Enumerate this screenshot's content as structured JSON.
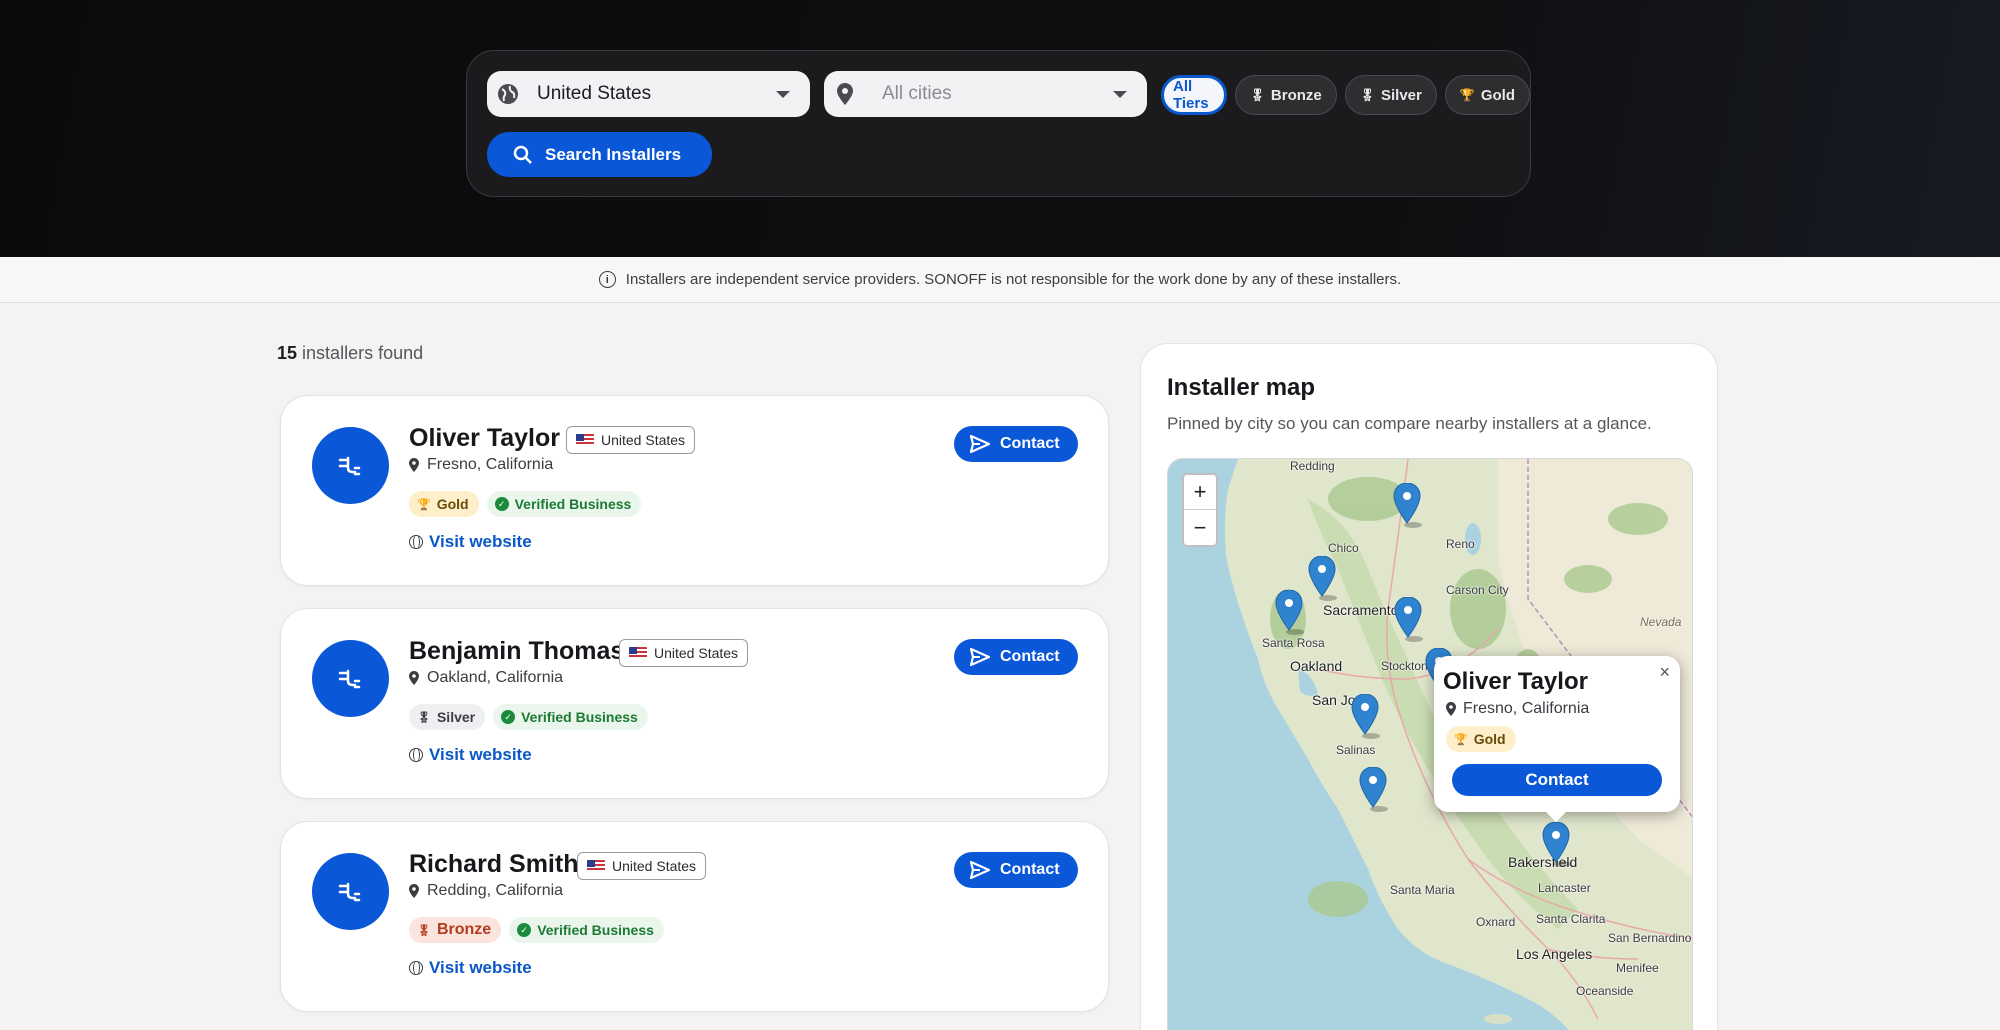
{
  "filters": {
    "country_value": "United States",
    "city_placeholder": "All cities",
    "tiers": [
      "All Tiers",
      "Bronze",
      "Silver",
      "Gold"
    ],
    "active_tier": "All Tiers",
    "search_label": "Search Installers"
  },
  "notice": "Installers are independent service providers. SONOFF is not responsible for the work done by any of these installers.",
  "results": {
    "count": "15",
    "suffix": "installers found"
  },
  "installers": [
    {
      "name": "Oliver Taylor",
      "country": "United States",
      "location": "Fresno, California",
      "tier": "Gold",
      "verified": "Verified Business",
      "website_label": "Visit website",
      "contact_label": "Contact"
    },
    {
      "name": "Benjamin Thomas",
      "country": "United States",
      "location": "Oakland, California",
      "tier": "Silver",
      "verified": "Verified Business",
      "website_label": "Visit website",
      "contact_label": "Contact"
    },
    {
      "name": "Richard Smith",
      "country": "United States",
      "location": "Redding, California",
      "tier": "Bronze",
      "verified": "Verified Business",
      "website_label": "Visit website",
      "contact_label": "Contact"
    }
  ],
  "map": {
    "title": "Installer map",
    "subtitle": "Pinned by city so you can compare nearby installers at a glance.",
    "zoom_in": "+",
    "zoom_out": "−",
    "city_labels": [
      "Redding",
      "Chico",
      "Reno",
      "Carson City",
      "Sacramento",
      "Santa Rosa",
      "Oakland",
      "Stockton",
      "San Jose",
      "Salinas",
      "Bakersfield",
      "Santa Maria",
      "Lancaster",
      "Oxnard",
      "Santa Clarita",
      "San Bernardino",
      "Los Angeles",
      "Menifee",
      "Oceanside",
      "Nevada"
    ],
    "popup": {
      "name": "Oliver Taylor",
      "location": "Fresno, California",
      "tier": "Gold",
      "contact_label": "Contact",
      "close": "×"
    }
  },
  "colors": {
    "primary": "#0a58d8",
    "gold_bg": "#fcefc9",
    "verified": "#1c7a34",
    "bronze": "#b23c1e"
  }
}
